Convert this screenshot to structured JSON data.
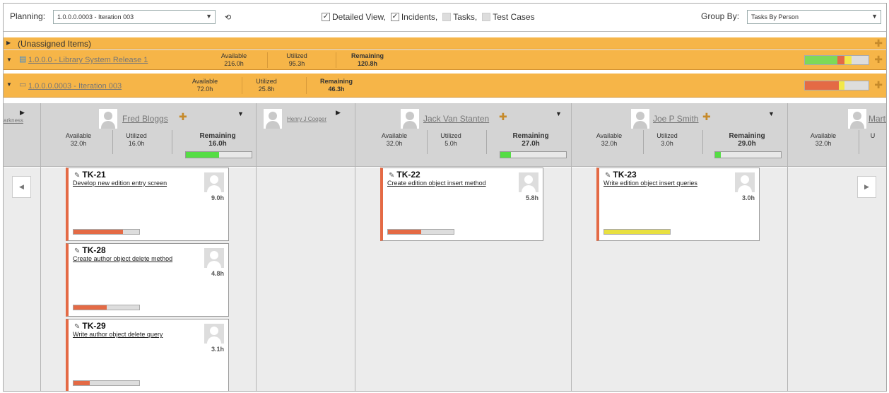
{
  "toolbar": {
    "planning_label": "Planning:",
    "planning_value": "1.0.0.0.0003 - Iteration 003",
    "detailed_view": "Detailed View,",
    "incidents": "Incidents,",
    "tasks": "Tasks,",
    "test_cases": "Test Cases",
    "group_by_label": "Group By:",
    "group_by_value": "Tasks By Person"
  },
  "unassigned": {
    "label": "(Unassigned Items)"
  },
  "release": {
    "name": "1.0.0.0 - Library System Release 1",
    "available_label": "Available",
    "available_value": "216.0h",
    "utilized_label": "Utilized",
    "utilized_value": "95.3h",
    "remaining_label": "Remaining",
    "remaining_value": "120.8h"
  },
  "iteration": {
    "name": "1.0.0.0.0003 - Iteration 003",
    "available_label": "Available",
    "available_value": "72.0h",
    "utilized_label": "Utilized",
    "utilized_value": "25.8h",
    "remaining_label": "Remaining",
    "remaining_value": "46.3h"
  },
  "people": [
    {
      "name": "arkness"
    },
    {
      "name": "Fred Bloggs",
      "available": "32.0h",
      "utilized": "16.0h",
      "remaining": "16.0h",
      "progress": 0.5
    },
    {
      "name": "Henry J Cooper"
    },
    {
      "name": "Jack Van Stanten",
      "available": "32.0h",
      "utilized": "5.0h",
      "remaining": "27.0h",
      "progress": 0.16
    },
    {
      "name": "Joe P Smith",
      "available": "32.0h",
      "utilized": "3.0h",
      "remaining": "29.0h",
      "progress": 0.09
    },
    {
      "name": "Marth",
      "available": "32.0h",
      "utilized": "U"
    }
  ],
  "labels": {
    "available": "Available",
    "utilized": "Utilized",
    "remaining": "Remaining"
  },
  "tasks": [
    {
      "id": "TK-21",
      "title": "Develop new edition entry screen",
      "hours": "9.0h",
      "progress": 0.75,
      "bar_color": "#e46a45"
    },
    {
      "id": "TK-28",
      "title": "Create author object delete method",
      "hours": "4.8h",
      "progress": 0.5,
      "bar_color": "#e46a45"
    },
    {
      "id": "TK-29",
      "title": "Write author object delete query",
      "hours": "3.1h",
      "progress": 0.25,
      "bar_color": "#e46a45"
    },
    {
      "id": "TK-22",
      "title": "Create edition object insert method",
      "hours": "5.8h",
      "progress": 0.5,
      "bar_color": "#e46a45"
    },
    {
      "id": "TK-23",
      "title": "Write edition object insert queries",
      "hours": "3.0h",
      "progress": 1.0,
      "bar_color": "#e8e040"
    }
  ],
  "icons": {
    "expand": "triangle-right-icon",
    "collapse": "triangle-down-icon",
    "add": "plus-icon",
    "refresh": "refresh-icon"
  }
}
